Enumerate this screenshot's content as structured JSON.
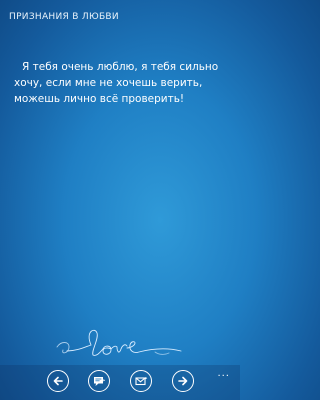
{
  "app": {
    "title": "ПРИЗНАНИЯ В ЛЮБВИ"
  },
  "message": {
    "text": "Я тебя очень люблю, я тебя сильно хочу, если мне не хочешь верить, можешь лично всё проверить!"
  },
  "decoration": {
    "handwriting_text": "love"
  },
  "appbar": {
    "buttons": [
      {
        "icon": "arrow-left-icon"
      },
      {
        "icon": "sms-message-icon"
      },
      {
        "icon": "email-icon"
      },
      {
        "icon": "arrow-right-icon"
      }
    ],
    "more_label": "..."
  }
}
